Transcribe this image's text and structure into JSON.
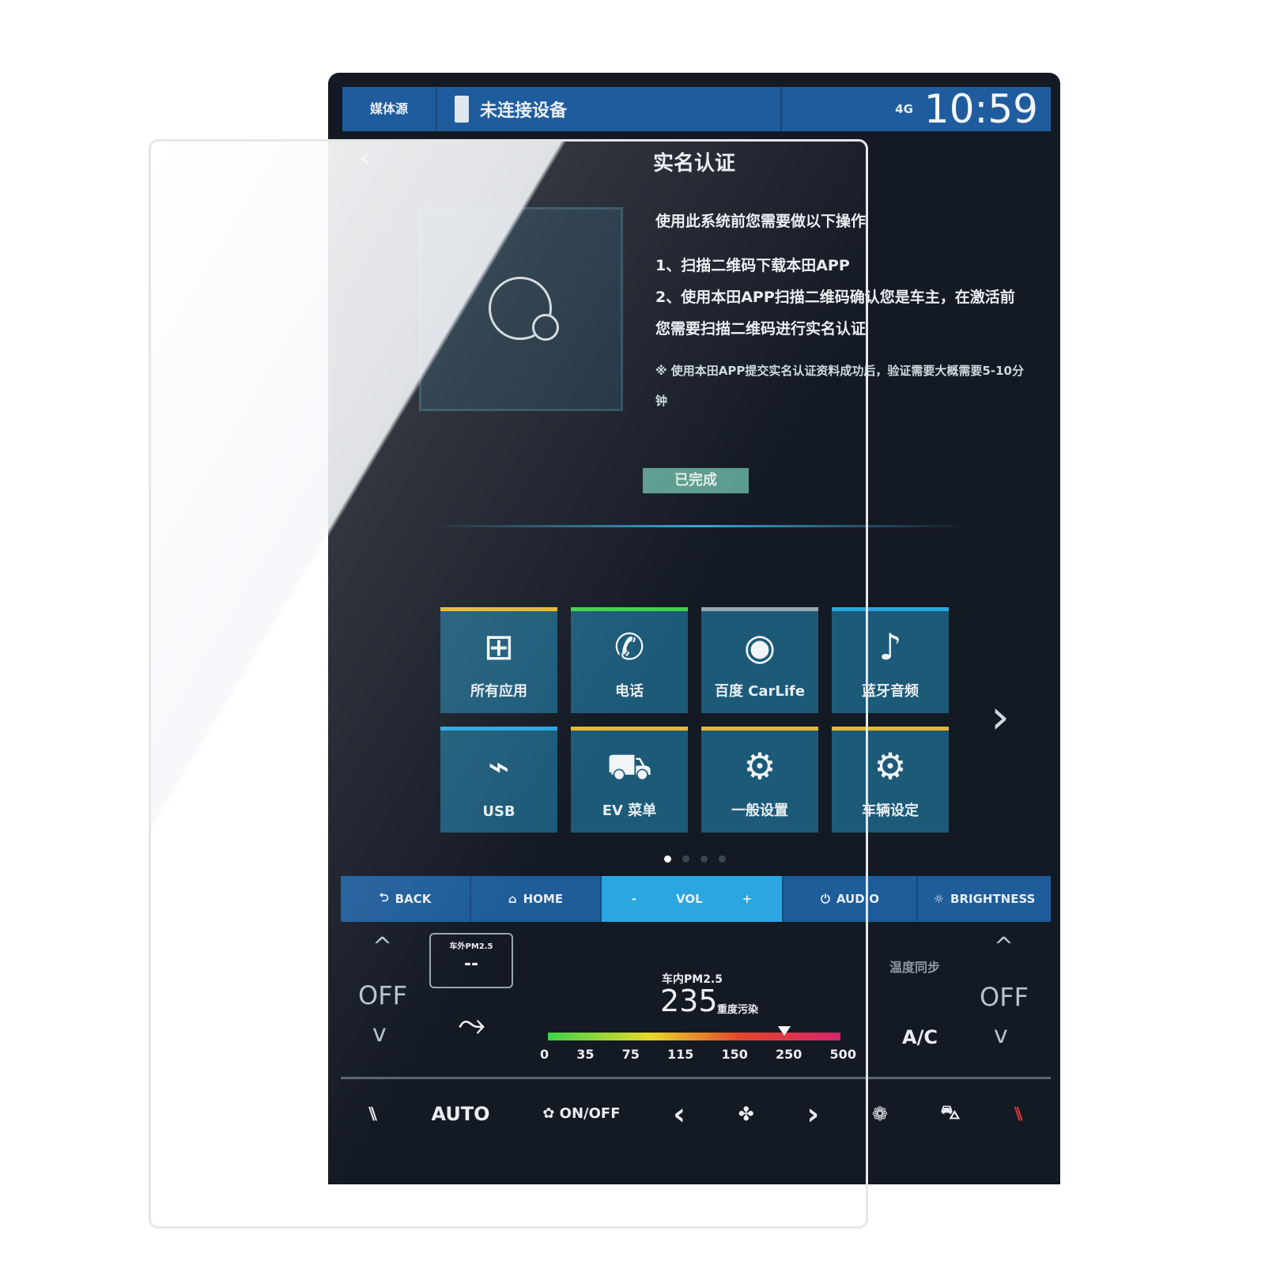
{
  "status_bar": {
    "source": "媒体源",
    "device": "未连接设备",
    "signal": "4G",
    "time": "10:59"
  },
  "page": {
    "back": "‹",
    "title": "实名认证",
    "instructions": {
      "heading": "使用此系统前您需要做以下操作",
      "step1": "1、扫描二维码下载本田APP",
      "step2": "2、使用本田APP扫描二维码确认您是车主，在激活前您需要扫描二维码进行实名认证",
      "note": "※ 使用本田APP提交实名认证资料成功后，验证需要大概需要5-10分钟"
    },
    "done_button": "已完成"
  },
  "apps": [
    {
      "label": "所有应用",
      "icon": "apps-grid-icon",
      "glyph": "⊞",
      "accent": "#e8b82a"
    },
    {
      "label": "电话",
      "icon": "phone-icon",
      "glyph": "✆",
      "accent": "#3fd24a"
    },
    {
      "label": "百度 CarLife",
      "icon": "carlife-icon",
      "glyph": "◉",
      "accent": "#9aa6b0"
    },
    {
      "label": "蓝牙音频",
      "icon": "bluetooth-audio-icon",
      "glyph": "♪",
      "accent": "#2aa6e0"
    },
    {
      "label": "USB",
      "icon": "usb-icon",
      "glyph": "⌁",
      "accent": "#2aa6e0"
    },
    {
      "label": "EV 菜单",
      "icon": "ev-menu-icon",
      "glyph": "⛟",
      "accent": "#e8b82a"
    },
    {
      "label": "一般设置",
      "icon": "settings-gear-icon",
      "glyph": "⚙",
      "accent": "#e8b82a"
    },
    {
      "label": "车辆设定",
      "icon": "vehicle-settings-icon",
      "glyph": "⚙",
      "accent": "#e8b82a"
    }
  ],
  "next_page": "›",
  "pager": {
    "pages": 4,
    "current": 1
  },
  "nav_bar": {
    "back": "BACK",
    "home": "HOME",
    "vol_minus": "-",
    "vol": "VOL",
    "vol_plus": "+",
    "audio": "AUDIO",
    "brightness": "BRIGHTNESS"
  },
  "climate": {
    "left_temp": "OFF",
    "right_temp": "OFF",
    "up": "^",
    "down": "v",
    "outside_pm_label": "车外PM2.5",
    "outside_pm_value": "--",
    "inside_pm_label": "车内PM2.5",
    "inside_pm_value": "235",
    "inside_pm_status": "重度污染",
    "pm_scale": [
      "0",
      "35",
      "75",
      "115",
      "150",
      "250",
      "500"
    ],
    "sync": "温度同步",
    "ac": "A/C"
  },
  "bottom_bar": {
    "auto": "AUTO",
    "fan_onoff": "ON/OFF",
    "prev": "‹",
    "next": "›"
  }
}
